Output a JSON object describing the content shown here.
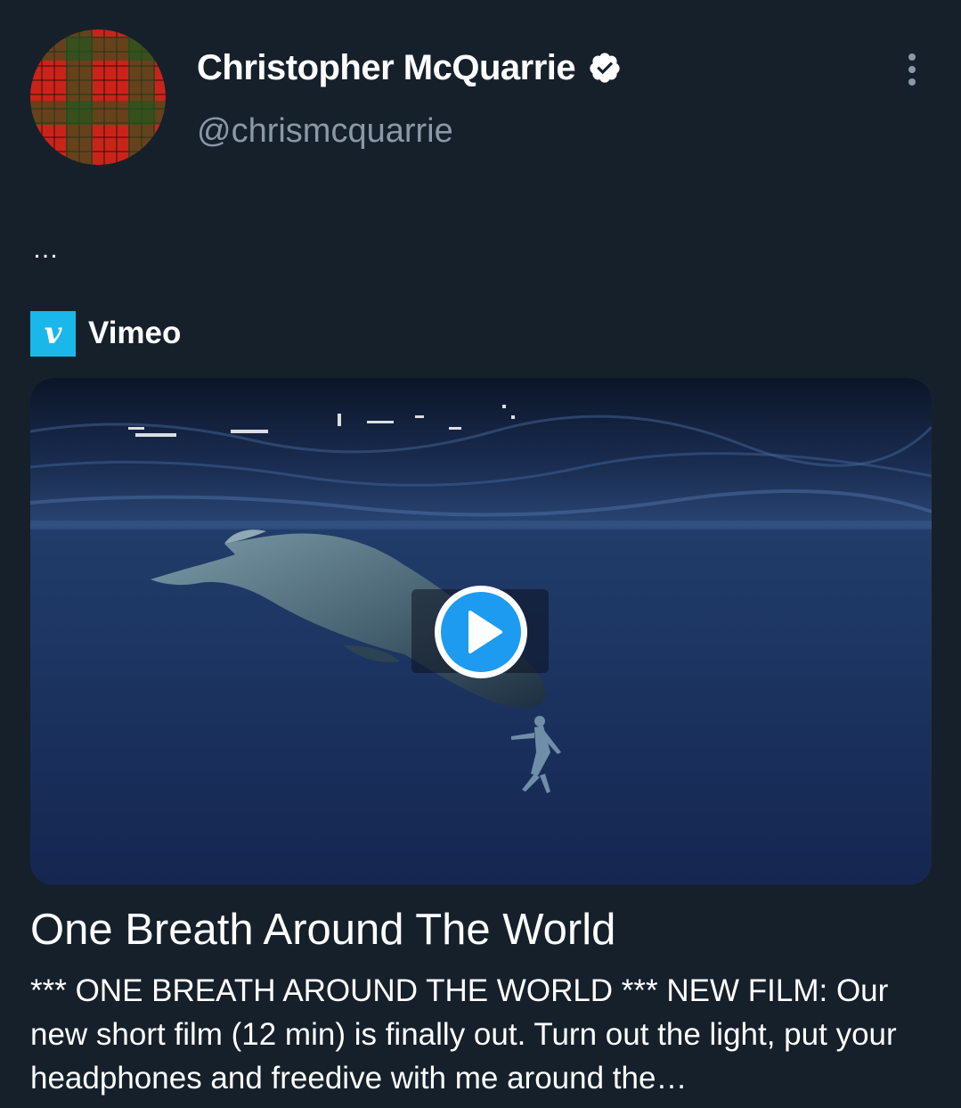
{
  "tweet": {
    "author": {
      "display_name": "Christopher McQuarrie",
      "handle": "@chrismcquarrie",
      "verified": true,
      "avatar": "red-green-tartan-avatar"
    },
    "truncated_text": "…",
    "more_icon": "more-vertical-icon"
  },
  "card": {
    "provider": {
      "name": "Vimeo",
      "icon_letter": "v",
      "icon_color": "#1ab7ea"
    },
    "media": {
      "description": "sperm-whale-and-freediver-underwater",
      "play_icon": "play-icon",
      "accent": "#1d9bf0"
    },
    "title": "One Breath Around The World",
    "description": "*** ONE BREATH AROUND THE WORLD *** NEW FILM: Our new short film (12 min) is finally out. Turn out the light, put your headphones and freedive with me around the…"
  },
  "theme": {
    "background": "#15202b",
    "secondary_text": "#8b98a5"
  }
}
